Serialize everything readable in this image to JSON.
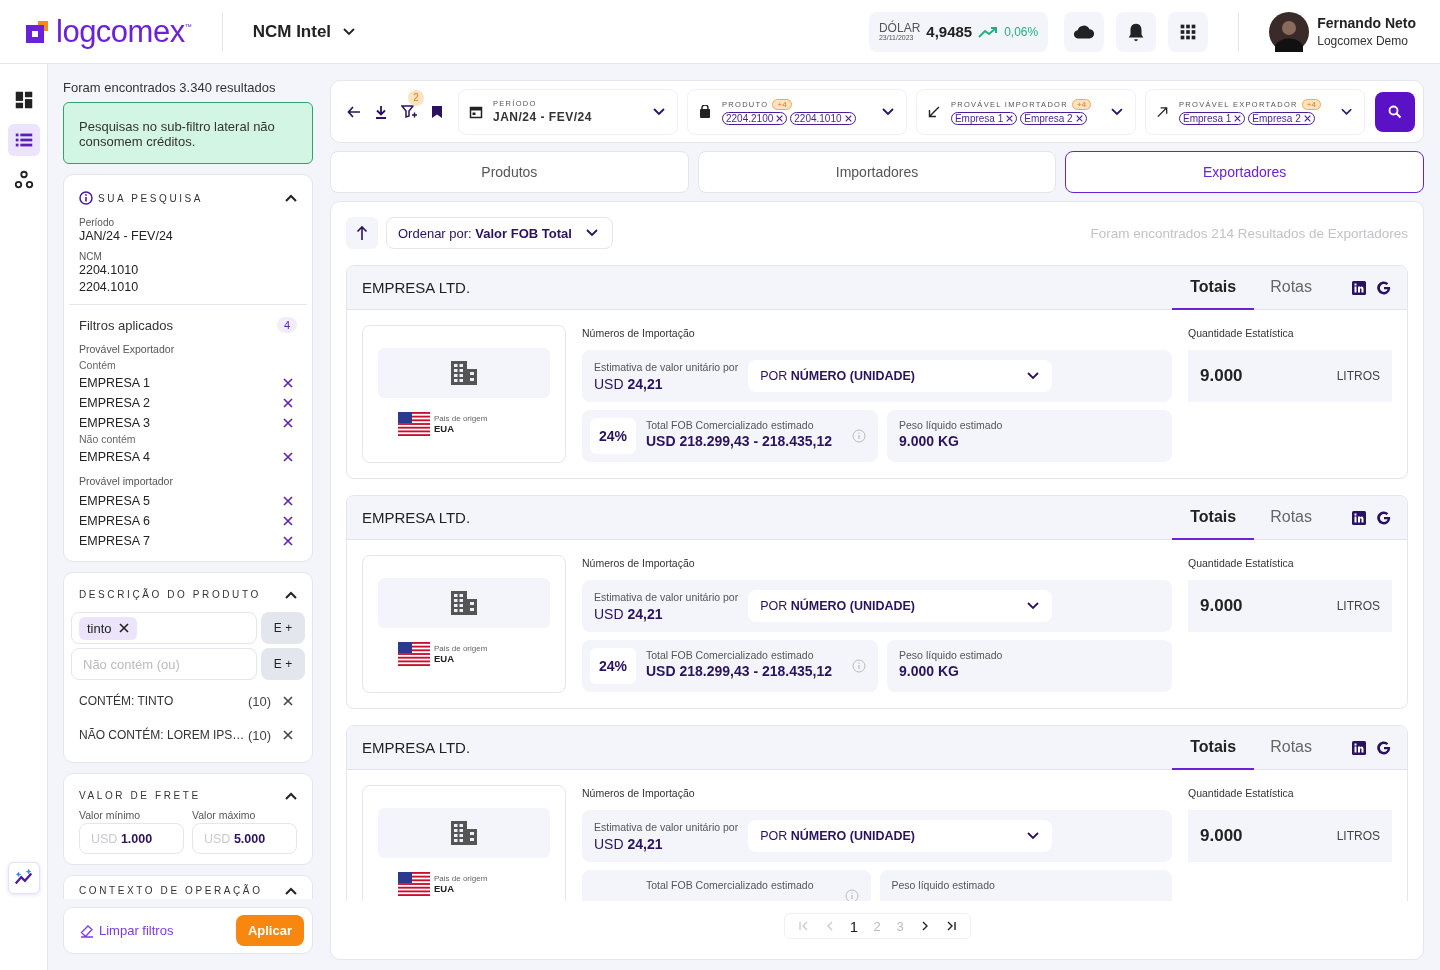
{
  "header": {
    "logo": "logcomex",
    "tm": "™",
    "module": "NCM Intel",
    "dollar": {
      "label": "DÓLAR",
      "date": "23/11/2023",
      "value": "4,9485",
      "change": "0,06%"
    },
    "user": {
      "name": "Fernando Neto",
      "company": "Logcomex Demo"
    }
  },
  "rail": [
    {
      "kind": "dashboard",
      "selected": false
    },
    {
      "kind": "list",
      "selected": true
    },
    {
      "kind": "network",
      "selected": false
    }
  ],
  "sidebar": {
    "results": "Foram encontrados 3.340 resultados",
    "notice": "Pesquisas no sub-filtro lateral não consomem créditos.",
    "search": {
      "title": "SUA PESQUISA",
      "expanded": true,
      "period_label": "Período",
      "period": "JAN/24 - FEV/24",
      "ncm_label": "NCM",
      "ncm": [
        "2204.1010",
        "2204.1010"
      ],
      "filters_label": "Filtros aplicados",
      "filters_count": "4",
      "groups": [
        {
          "title": "Provável Exportador",
          "subgroups": [
            {
              "label": "Contém",
              "items": [
                "EMPRESA 1",
                "EMPRESA 2",
                "EMPRESA 3"
              ]
            },
            {
              "label": "Não contém",
              "items": [
                "EMPRESA 4"
              ]
            }
          ]
        },
        {
          "title": "Provável importador",
          "subgroups": [
            {
              "items": [
                "EMPRESA 5",
                "EMPRESA 6",
                "EMPRESA 7"
              ]
            }
          ]
        }
      ]
    },
    "description": {
      "title": "DESCRIÇÃO DO PRODUTO",
      "expanded": true,
      "chips": [
        "tinto"
      ],
      "add_buttons": [
        "E +",
        "E +"
      ],
      "not_placeholder": "Não contém (ou)",
      "rules": [
        {
          "text": "CONTÉM: TINTO",
          "count": "(10)"
        },
        {
          "text": "NÃO CONTÉM: LOREM IPS…",
          "count": "(10)"
        }
      ]
    },
    "freight": {
      "title": "VALOR DE FRETE",
      "expanded": true,
      "fields": [
        {
          "label": "Valor mínimo",
          "prefix": "USD",
          "value": "1.000"
        },
        {
          "label": "Valor máximo",
          "prefix": "USD",
          "value": "5.000"
        }
      ]
    },
    "context": {
      "title": "CONTEXTO DE OPERAÇÃO",
      "expanded": true
    },
    "footer": {
      "clear": "Limpar filtros",
      "apply": "Aplicar"
    }
  },
  "filterbar": {
    "badge": "2",
    "filters": [
      {
        "kind": "period",
        "label": "PERÍODO",
        "value": "JAN/24 - FEV/24"
      },
      {
        "kind": "product",
        "label": "PRODUTO",
        "more": "+4",
        "chips": [
          "2204.2100",
          "2204.1010"
        ]
      },
      {
        "kind": "importer",
        "label": "PROVÁVEL IMPORTADOR",
        "more": "+4",
        "chips": [
          "Empresa 1",
          "Empresa 2"
        ]
      },
      {
        "kind": "exporter",
        "label": "PROVÁVEL EXPORTADOR",
        "more": "+4",
        "chips": [
          "Empresa 1",
          "Empresa 2"
        ]
      }
    ]
  },
  "tabs": [
    {
      "label": "Produtos",
      "selected": false
    },
    {
      "label": "Importadores",
      "selected": false
    },
    {
      "label": "Exportadores",
      "selected": true
    }
  ],
  "results": {
    "sort_label": "Ordenar por:",
    "sort_value": "Valor FOB Total",
    "summary": "Foram encontrados 214 Resultados de Exportadores",
    "cards": [
      {
        "name": "EMPRESA LTD.",
        "tabs": [
          {
            "label": "Totais",
            "selected": true
          },
          {
            "label": "Rotas",
            "selected": false
          }
        ],
        "country_label": "Pais de origem",
        "country": "EUA",
        "section": "Números de Importação",
        "unit_label": "Estimativa de valor unitário por",
        "unit_currency": "USD",
        "unit_value": "24,21",
        "unit_prefix": "POR",
        "unit_select": "NÚMERO (UNIDADE)",
        "share": "24%",
        "fob_label": "Total FOB Comercializado estimado",
        "fob": "USD 218.299,43 - 218.435,12",
        "weight_label": "Peso líquido estimado",
        "weight": "9.000 KG",
        "qty_label": "Quantidade Estatística",
        "qty": "9.000",
        "qty_unit": "LITROS"
      },
      {
        "name": "EMPRESA LTD.",
        "tabs": [
          {
            "label": "Totais",
            "selected": true
          },
          {
            "label": "Rotas",
            "selected": false
          }
        ],
        "country_label": "Pais de origem",
        "country": "EUA",
        "section": "Números de Importação",
        "unit_label": "Estimativa de valor unitário por",
        "unit_currency": "USD",
        "unit_value": "24,21",
        "unit_prefix": "POR",
        "unit_select": "NÚMERO (UNIDADE)",
        "share": "24%",
        "fob_label": "Total FOB Comercializado estimado",
        "fob": "USD 218.299,43 - 218.435,12",
        "weight_label": "Peso líquido estimado",
        "weight": "9.000 KG",
        "qty_label": "Quantidade Estatística",
        "qty": "9.000",
        "qty_unit": "LITROS"
      },
      {
        "name": "EMPRESA LTD.",
        "tabs": [
          {
            "label": "Totais",
            "selected": true
          },
          {
            "label": "Rotas",
            "selected": false
          }
        ],
        "country_label": "Pais de origem",
        "country": "EUA",
        "section": "Números de Importação",
        "unit_label": "Estimativa de valor unitário por",
        "unit_currency": "USD",
        "unit_value": "24,21",
        "unit_prefix": "POR",
        "unit_select": "NÚMERO (UNIDADE)",
        "fob_label": "Total FOB Comercializado estimado",
        "weight_label": "Peso líquido estimado",
        "qty_label": "Quantidade Estatística",
        "qty": "9.000",
        "qty_unit": "LITROS"
      }
    ]
  },
  "pagination": {
    "first_disabled": true,
    "prev_disabled": true,
    "next_disabled": false,
    "last_disabled": false,
    "pages": [
      {
        "label": "1",
        "selected": true
      },
      {
        "label": "2",
        "selected": false
      },
      {
        "label": "3",
        "selected": false
      }
    ]
  }
}
